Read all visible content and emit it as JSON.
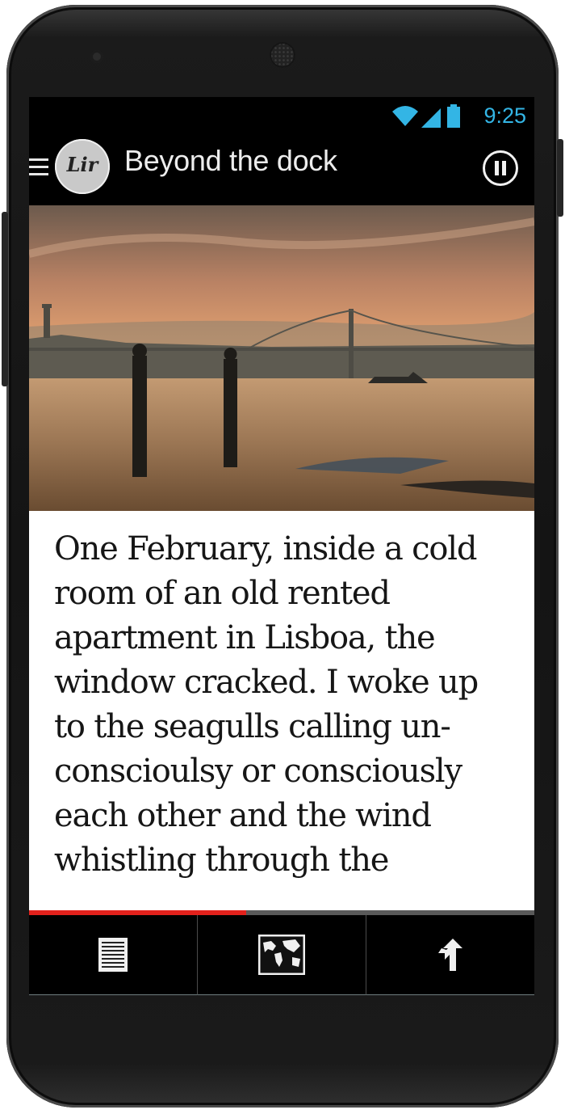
{
  "status_bar": {
    "time": "9:25",
    "icons": [
      "wifi-icon",
      "cell-signal-icon",
      "battery-icon"
    ]
  },
  "action_bar": {
    "menu_icon": "menu-icon",
    "logo_text": "Lir",
    "title": "Beyond the dock",
    "pause_icon": "pause-icon"
  },
  "hero_image": {
    "description_icon": "photo"
  },
  "reader": {
    "text": "One February, inside a cold\nroom of an old rented\napartment in Lisboa, the\nwindow cracked. I woke up\nto the seagulls calling un-\nconscioulsy or consciously\neach other and the wind\nwhistling through the",
    "progress": 0.43
  },
  "bottom_nav": {
    "items": [
      {
        "icon": "text-icon"
      },
      {
        "icon": "map-icon"
      },
      {
        "icon": "directions-icon"
      }
    ]
  },
  "colors": {
    "accent": "#33b5e5",
    "progress": "#e2211c"
  }
}
